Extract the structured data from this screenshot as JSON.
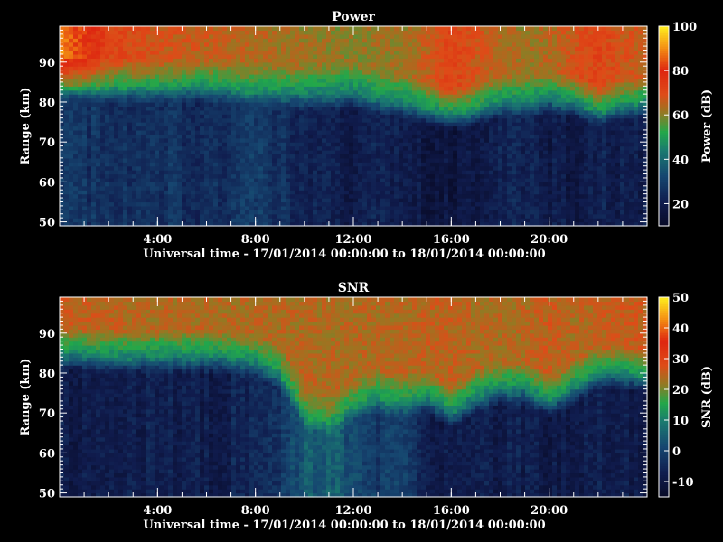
{
  "chart_data": [
    {
      "type": "heatmap",
      "title": "Power",
      "xlabel": "Universal time - 17/01/2014 00:00:00 to 18/01/2014 00:00:00",
      "ylabel": "Range (km)",
      "x_range_hours": [
        0,
        24
      ],
      "x_ticks": [
        {
          "value": 4,
          "label": "4:00"
        },
        {
          "value": 8,
          "label": "8:00"
        },
        {
          "value": 12,
          "label": "12:00"
        },
        {
          "value": 16,
          "label": "16:00"
        },
        {
          "value": 20,
          "label": "20:00"
        }
      ],
      "ylim": [
        49,
        99
      ],
      "y_ticks": [
        {
          "value": 50,
          "label": "50"
        },
        {
          "value": 60,
          "label": "60"
        },
        {
          "value": 70,
          "label": "70"
        },
        {
          "value": 80,
          "label": "80"
        },
        {
          "value": 90,
          "label": "90"
        }
      ],
      "colorbar": {
        "label": "Power (dB)",
        "range": [
          10,
          100
        ],
        "ticks": [
          {
            "value": 20,
            "label": "20"
          },
          {
            "value": 40,
            "label": "40"
          },
          {
            "value": 60,
            "label": "60"
          },
          {
            "value": 80,
            "label": "80"
          },
          {
            "value": 100,
            "label": "100"
          }
        ]
      },
      "profile": {
        "hours": [
          0,
          2,
          4,
          6,
          8,
          10,
          12,
          13,
          14,
          15,
          16,
          17,
          18,
          19,
          20,
          21,
          22,
          23,
          24
        ],
        "echo_base_km": [
          85,
          84,
          84,
          84,
          83,
          82,
          82,
          81,
          80,
          78,
          77,
          78,
          80,
          80,
          81,
          80,
          78,
          79,
          80
        ],
        "background_db": [
          28,
          26,
          27,
          25,
          30,
          22,
          20,
          22,
          20,
          18,
          16,
          20,
          22,
          24,
          20,
          18,
          22,
          20,
          20
        ],
        "top_db": [
          90,
          72,
          68,
          66,
          64,
          62,
          60,
          62,
          62,
          66,
          72,
          68,
          64,
          62,
          64,
          68,
          72,
          68,
          66
        ]
      }
    },
    {
      "type": "heatmap",
      "title": "SNR",
      "xlabel": "Universal time - 17/01/2014 00:00:00 to 18/01/2014 00:00:00",
      "ylabel": "Range (km)",
      "x_range_hours": [
        0,
        24
      ],
      "x_ticks": [
        {
          "value": 4,
          "label": "4:00"
        },
        {
          "value": 8,
          "label": "8:00"
        },
        {
          "value": 12,
          "label": "12:00"
        },
        {
          "value": 16,
          "label": "16:00"
        },
        {
          "value": 20,
          "label": "20:00"
        }
      ],
      "ylim": [
        49,
        99
      ],
      "y_ticks": [
        {
          "value": 50,
          "label": "50"
        },
        {
          "value": 60,
          "label": "60"
        },
        {
          "value": 70,
          "label": "70"
        },
        {
          "value": 80,
          "label": "80"
        },
        {
          "value": 90,
          "label": "90"
        }
      ],
      "colorbar": {
        "label": "SNR (dB)",
        "range": [
          -15,
          50
        ],
        "ticks": [
          {
            "value": -10,
            "label": "-10"
          },
          {
            "value": 0,
            "label": "0"
          },
          {
            "value": 10,
            "label": "10"
          },
          {
            "value": 20,
            "label": "20"
          },
          {
            "value": 30,
            "label": "30"
          },
          {
            "value": 40,
            "label": "40"
          },
          {
            "value": 50,
            "label": "50"
          }
        ]
      },
      "profile": {
        "hours": [
          0,
          2,
          4,
          6,
          8,
          9,
          10,
          11,
          12,
          13,
          14,
          15,
          16,
          17,
          18,
          19,
          20,
          21,
          22,
          23,
          24
        ],
        "echo_base_km": [
          85,
          84,
          84,
          84,
          83,
          80,
          70,
          68,
          72,
          74,
          73,
          74,
          70,
          74,
          76,
          76,
          73,
          76,
          80,
          80,
          79
        ],
        "background_db": [
          -8,
          -8,
          -7,
          -8,
          -5,
          -2,
          4,
          6,
          2,
          -2,
          0,
          -6,
          -9,
          -8,
          -7,
          -7,
          -8,
          -8,
          -7,
          -8,
          -8
        ],
        "top_db": [
          26,
          25,
          24,
          24,
          24,
          24,
          24,
          24,
          24,
          24,
          24,
          25,
          25,
          24,
          24,
          24,
          26,
          24,
          25,
          26,
          26
        ]
      }
    }
  ]
}
